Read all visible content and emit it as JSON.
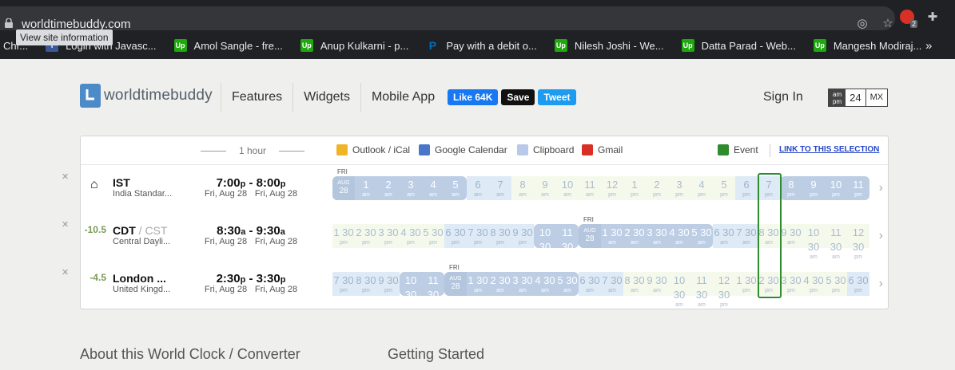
{
  "browser": {
    "url": "worldtimebuddy.com",
    "tooltip": "View site information",
    "bookmarks": [
      {
        "label": "Chr...",
        "icon": "chrome-icon"
      },
      {
        "label": "Login with Javasc...",
        "icon": "facebook-icon",
        "badge": "f"
      },
      {
        "label": "Amol Sangle - fre...",
        "icon": "upwork-icon",
        "badge": "Up"
      },
      {
        "label": "Anup Kulkarni - p...",
        "icon": "upwork-icon",
        "badge": "Up"
      },
      {
        "label": "Pay with a debit o...",
        "icon": "paypal-icon",
        "badge": "P"
      },
      {
        "label": "Nilesh Joshi - We...",
        "icon": "upwork-icon",
        "badge": "Up"
      },
      {
        "label": "Datta Parad - Web...",
        "icon": "upwork-icon",
        "badge": "Up"
      },
      {
        "label": "Mangesh Modiraj...",
        "icon": "upwork-icon",
        "badge": "Up"
      }
    ],
    "more": "»",
    "extension_badge": "2"
  },
  "site": {
    "logo": "worldtimebuddy",
    "nav": [
      "Features",
      "Widgets",
      "Mobile App"
    ],
    "social": {
      "like": "Like 64K",
      "save": "Save",
      "tweet": "Tweet"
    },
    "signin": "Sign In",
    "format": {
      "ampm_top": "am",
      "ampm_bottom": "pm",
      "h24": "24",
      "mx": "MX"
    }
  },
  "toolbar": {
    "hour_guide": "1 hour",
    "outlook": "Outlook / iCal",
    "gcal": "Google Calendar",
    "clipboard": "Clipboard",
    "gmail": "Gmail",
    "event": "Event",
    "link": "LINK TO THIS SELECTION"
  },
  "rows": [
    {
      "offset": "",
      "home": true,
      "name": "IST",
      "name_extra": "",
      "sub": "India Standar...",
      "t1": "7:00",
      "t1s": "p",
      "t2": "8:00",
      "t2s": "p",
      "d1": "Fri, Aug 28",
      "d2": "Fri, Aug 28",
      "daytag": "FRI",
      "cells": [
        [
          "AUG",
          "28",
          "day"
        ],
        [
          "1",
          "am",
          "dark"
        ],
        [
          "2",
          "am",
          "dark"
        ],
        [
          "3",
          "am",
          "dark"
        ],
        [
          "4",
          "am",
          "dark"
        ],
        [
          "5",
          "am",
          "dark"
        ],
        [
          "6",
          "am",
          "light"
        ],
        [
          "7",
          "am",
          "light"
        ],
        [
          "8",
          "am",
          "pale"
        ],
        [
          "9",
          "am",
          "pale"
        ],
        [
          "10",
          "am",
          "pale"
        ],
        [
          "11",
          "am",
          "pale"
        ],
        [
          "12",
          "pm",
          "pale"
        ],
        [
          "1",
          "pm",
          "pale"
        ],
        [
          "2",
          "pm",
          "pale"
        ],
        [
          "3",
          "pm",
          "pale"
        ],
        [
          "4",
          "pm",
          "pale"
        ],
        [
          "5",
          "pm",
          "pale"
        ],
        [
          "6",
          "pm",
          "light"
        ],
        [
          "7",
          "pm",
          "light"
        ],
        [
          "8",
          "pm",
          "dark"
        ],
        [
          "9",
          "pm",
          "dark"
        ],
        [
          "10",
          "pm",
          "dark"
        ],
        [
          "11",
          "pm",
          "dark"
        ]
      ]
    },
    {
      "offset": "-10.5",
      "home": false,
      "name": "CDT",
      "name_extra": " / CST",
      "sub": "Central Dayli...",
      "t1": "8:30",
      "t1s": "a",
      "t2": "9:30",
      "t2s": "a",
      "d1": "Fri, Aug 28",
      "d2": "Fri, Aug 28",
      "daytag": "FRI",
      "cells": [
        [
          "1 30",
          "pm",
          "pale"
        ],
        [
          "2 30",
          "pm",
          "pale"
        ],
        [
          "3 30",
          "pm",
          "pale"
        ],
        [
          "4 30",
          "pm",
          "pale"
        ],
        [
          "5 30",
          "pm",
          "pale"
        ],
        [
          "6 30",
          "pm",
          "light"
        ],
        [
          "7 30",
          "pm",
          "light"
        ],
        [
          "8 30",
          "pm",
          "light"
        ],
        [
          "9 30",
          "pm",
          "light"
        ],
        [
          "10 30",
          "pm",
          "dark"
        ],
        [
          "11 30",
          "pm",
          "dark"
        ],
        [
          "AUG",
          "28",
          "day"
        ],
        [
          "1 30",
          "am",
          "dark"
        ],
        [
          "2 30",
          "am",
          "dark"
        ],
        [
          "3 30",
          "am",
          "dark"
        ],
        [
          "4 30",
          "am",
          "dark"
        ],
        [
          "5 30",
          "am",
          "dark"
        ],
        [
          "6 30",
          "am",
          "light"
        ],
        [
          "7 30",
          "am",
          "light"
        ],
        [
          "8 30",
          "am",
          "pale"
        ],
        [
          "9 30",
          "am",
          "pale"
        ],
        [
          "10 30",
          "am",
          "pale"
        ],
        [
          "11 30",
          "am",
          "pale"
        ],
        [
          "12 30",
          "pm",
          "pale"
        ]
      ]
    },
    {
      "offset": "-4.5",
      "home": false,
      "name": "London ...",
      "name_extra": "",
      "sub": "United Kingd...",
      "t1": "2:30",
      "t1s": "p",
      "t2": "3:30",
      "t2s": "p",
      "d1": "Fri, Aug 28",
      "d2": "Fri, Aug 28",
      "daytag": "FRI",
      "cells": [
        [
          "7 30",
          "pm",
          "light"
        ],
        [
          "8 30",
          "pm",
          "light"
        ],
        [
          "9 30",
          "pm",
          "light"
        ],
        [
          "10 30",
          "pm",
          "dark"
        ],
        [
          "11 30",
          "pm",
          "dark"
        ],
        [
          "AUG",
          "28",
          "day"
        ],
        [
          "1 30",
          "am",
          "dark"
        ],
        [
          "2 30",
          "am",
          "dark"
        ],
        [
          "3 30",
          "am",
          "dark"
        ],
        [
          "4 30",
          "am",
          "dark"
        ],
        [
          "5 30",
          "am",
          "dark"
        ],
        [
          "6 30",
          "am",
          "light"
        ],
        [
          "7 30",
          "am",
          "light"
        ],
        [
          "8 30",
          "am",
          "pale"
        ],
        [
          "9 30",
          "am",
          "pale"
        ],
        [
          "10 30",
          "am",
          "pale"
        ],
        [
          "11 30",
          "am",
          "pale"
        ],
        [
          "12 30",
          "pm",
          "pale"
        ],
        [
          "1 30",
          "pm",
          "pale"
        ],
        [
          "2 30",
          "pm",
          "pale"
        ],
        [
          "3 30",
          "pm",
          "pale"
        ],
        [
          "4 30",
          "pm",
          "pale"
        ],
        [
          "5 30",
          "pm",
          "pale"
        ],
        [
          "6 30",
          "pm",
          "light"
        ]
      ]
    }
  ],
  "footer": {
    "about": "About this World Clock / Converter",
    "start": "Getting Started"
  }
}
